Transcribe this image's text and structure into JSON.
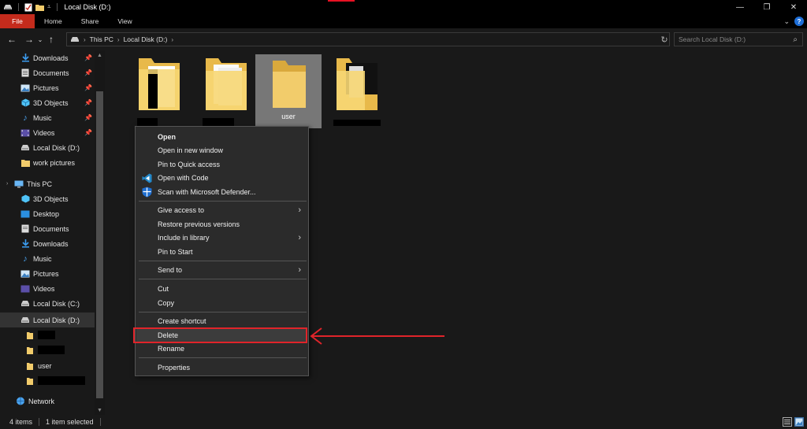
{
  "window": {
    "title": "Local Disk (D:)",
    "controls": [
      "—",
      "❐",
      "✕"
    ]
  },
  "ribbon": {
    "tabs": [
      "File",
      "Home",
      "Share",
      "View"
    ]
  },
  "address": {
    "crumbs": [
      "This PC",
      "Local Disk (D:)"
    ],
    "search_placeholder": "Search Local Disk (D:)"
  },
  "sidebar": {
    "quick_access": [
      {
        "label": "Downloads",
        "pinned": true
      },
      {
        "label": "Documents",
        "pinned": true
      },
      {
        "label": "Pictures",
        "pinned": true
      },
      {
        "label": "3D Objects",
        "pinned": true
      },
      {
        "label": "Music",
        "pinned": true
      },
      {
        "label": "Videos",
        "pinned": true
      },
      {
        "label": "Local Disk (D:)",
        "pinned": false
      },
      {
        "label": "work pictures",
        "pinned": false
      }
    ],
    "this_pc": "This PC",
    "this_pc_items": [
      "3D Objects",
      "Desktop",
      "Documents",
      "Downloads",
      "Music",
      "Pictures",
      "Videos",
      "Local Disk (C:)",
      "Local Disk (D:)"
    ],
    "d_children": [
      "user"
    ],
    "network": "Network"
  },
  "content": {
    "folders": [
      {
        "name": ""
      },
      {
        "name": ""
      },
      {
        "name": "user"
      },
      {
        "name": ""
      }
    ]
  },
  "context_menu": {
    "open": "Open",
    "open_new_window": "Open in new window",
    "pin_quick_access": "Pin to Quick access",
    "open_with_code": "Open with Code",
    "scan_defender": "Scan with Microsoft Defender...",
    "give_access": "Give access to",
    "restore_versions": "Restore previous versions",
    "include_library": "Include in library",
    "pin_start": "Pin to Start",
    "send_to": "Send to",
    "cut": "Cut",
    "copy": "Copy",
    "create_shortcut": "Create shortcut",
    "delete": "Delete",
    "rename": "Rename",
    "properties": "Properties"
  },
  "status": {
    "items": "4 items",
    "selected": "1 item selected"
  },
  "colors": {
    "accent_red": "#e0242a",
    "file_tab": "#c42b1c",
    "folder": "#f2cc6b"
  }
}
